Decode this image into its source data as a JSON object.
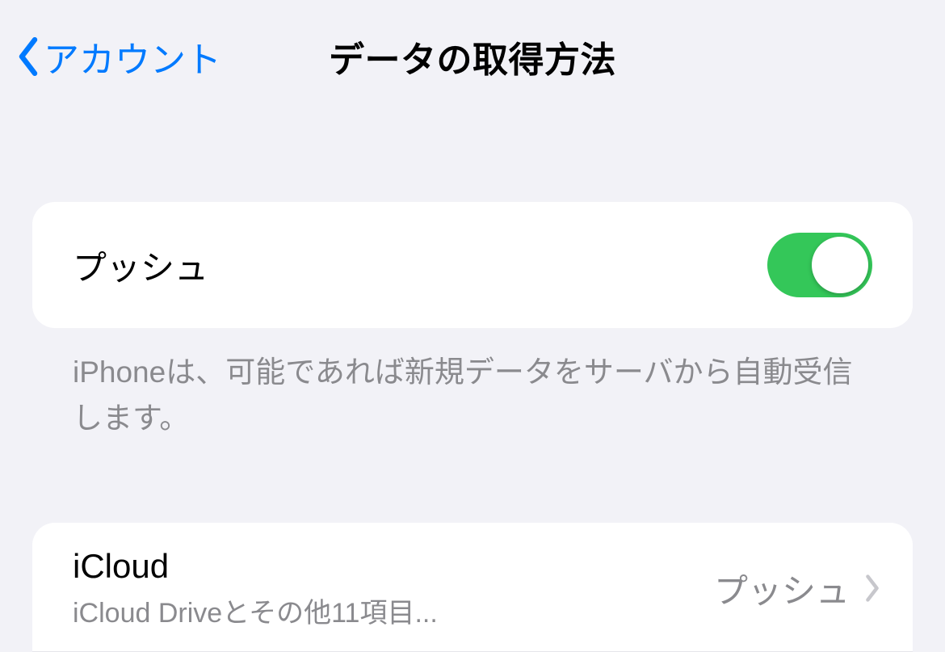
{
  "nav": {
    "back_label": "アカウント",
    "title": "データの取得方法"
  },
  "push": {
    "label": "プッシュ",
    "enabled": true,
    "footer": "iPhoneは、可能であれば新規データをサーバから自動受信します。"
  },
  "accounts": [
    {
      "title": "iCloud",
      "subtitle": "iCloud Driveとその他11項目...",
      "value": "プッシュ"
    }
  ]
}
